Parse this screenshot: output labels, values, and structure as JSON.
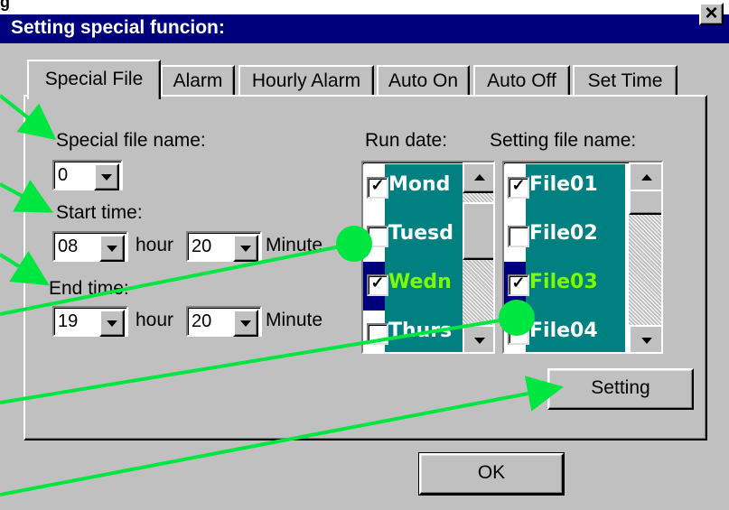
{
  "top_caption": "g",
  "window": {
    "title": "Setting special funcion:",
    "close_label": "×"
  },
  "tabs": [
    {
      "label": "Special File",
      "active": true
    },
    {
      "label": "Alarm",
      "active": false
    },
    {
      "label": "Hourly Alarm",
      "active": false
    },
    {
      "label": "Auto On",
      "active": false
    },
    {
      "label": "Auto Off",
      "active": false
    },
    {
      "label": "Set Time",
      "active": false
    }
  ],
  "special_file": {
    "name_label": "Special file name:",
    "name_value": "0",
    "start_label": "Start time:",
    "start_hour": "08",
    "start_minute": "20",
    "end_label": "End time:",
    "end_hour": "19",
    "end_minute": "20",
    "hour_label": "hour",
    "minute_label": "Minute"
  },
  "run_date": {
    "label": "Run date:",
    "items": [
      {
        "text": "Mond",
        "checked": true,
        "selected": false
      },
      {
        "text": "Tuesd",
        "checked": false,
        "selected": false
      },
      {
        "text": "Wedn",
        "checked": true,
        "selected": true
      },
      {
        "text": "Thurs",
        "checked": false,
        "selected": false
      }
    ]
  },
  "setting_file": {
    "label": "Setting file name:",
    "items": [
      {
        "text": "File01",
        "checked": true,
        "selected": false
      },
      {
        "text": "File02",
        "checked": false,
        "selected": false
      },
      {
        "text": "File03",
        "checked": true,
        "selected": true
      },
      {
        "text": "File04",
        "checked": false,
        "selected": false
      }
    ]
  },
  "buttons": {
    "setting": "Setting",
    "ok": "OK"
  },
  "check_mark": "✓",
  "colors": {
    "title_bar": "#00007d",
    "list_bg": "#008080",
    "selected_text": "#7cfc00",
    "annotation": "#00e640",
    "face": "#c0c0c0"
  }
}
